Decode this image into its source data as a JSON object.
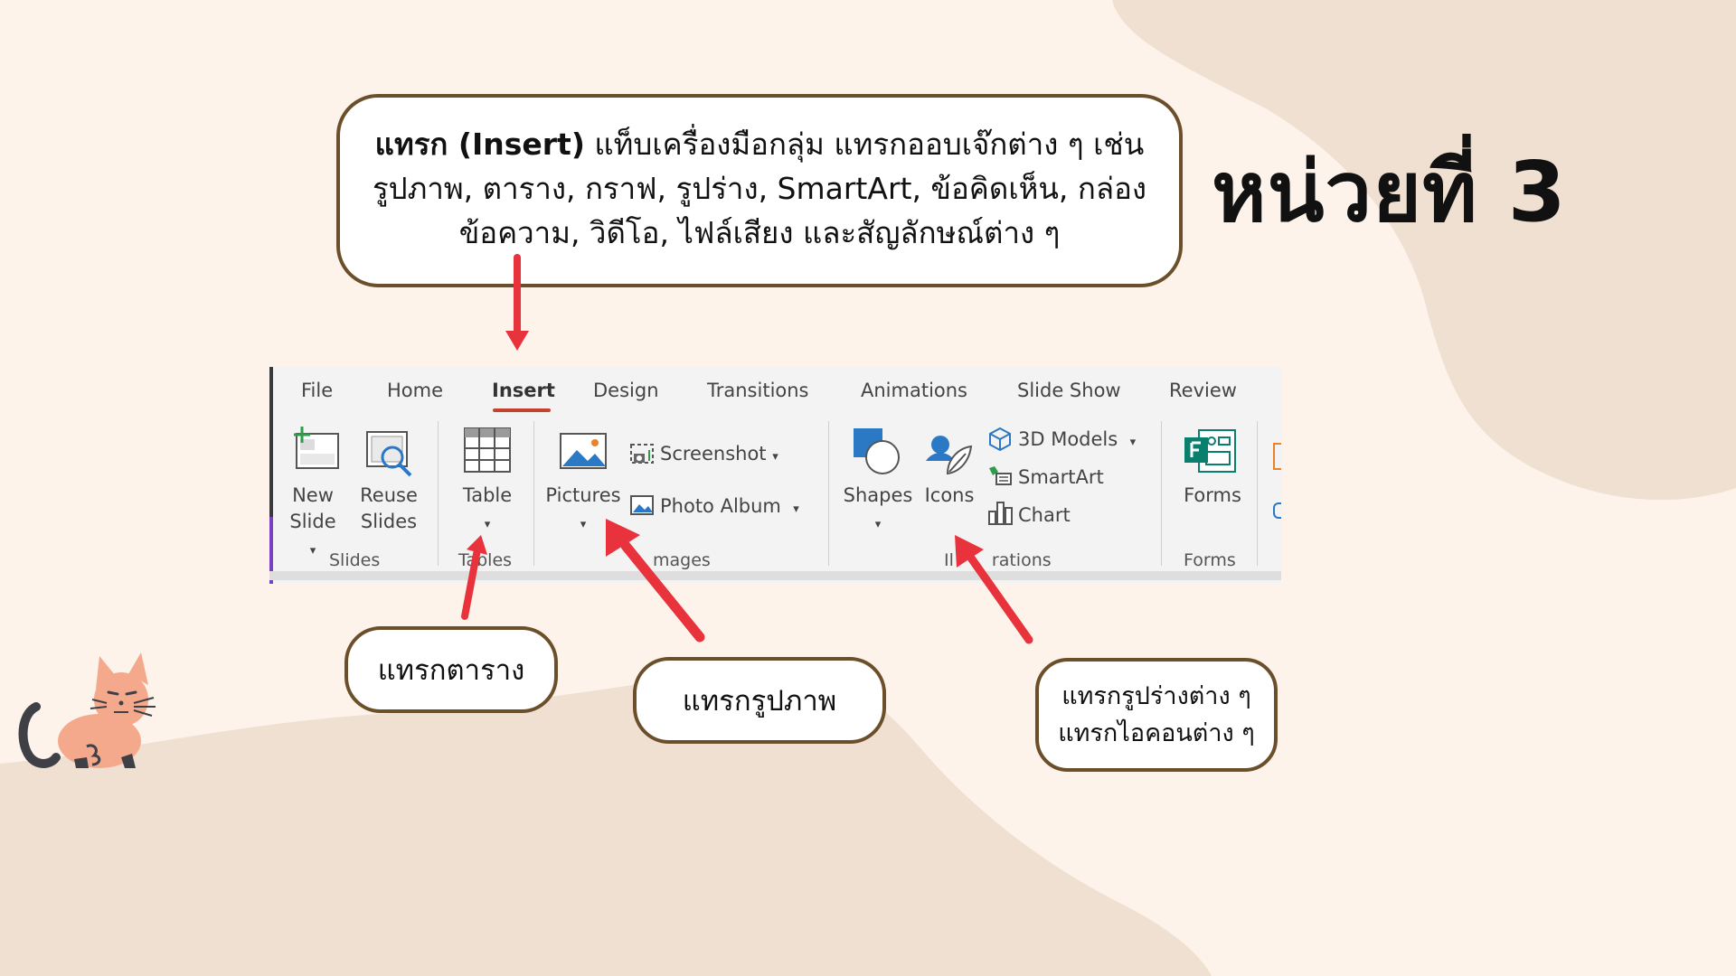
{
  "slide": {
    "title": "หน่วยที่ 3",
    "main_callout": {
      "bold_text": "แทรก (Insert)",
      "line1_rest": " แท็บเครื่องมือกลุ่ม แทรกออบเจ๊กต่าง ๆ เช่น",
      "line2": "รูปภาพ, ตาราง, กราฟ, รูปร่าง, SmartArt, ข้อคิดเห็น, กล่อง",
      "line3": "ข้อความ, วิดีโอ, ไฟล์เสียง และสัญลักษณ์ต่าง ๆ"
    },
    "callout_table": "แทรกตาราง",
    "callout_pictures": "แทรกรูปภาพ",
    "callout_shapes_line1": "แทรกรูปร่างต่าง ๆ",
    "callout_shapes_line2": "แทรกไอคอนต่าง ๆ"
  },
  "ribbon": {
    "tabs": [
      "File",
      "Home",
      "Insert",
      "Design",
      "Transitions",
      "Animations",
      "Slide Show",
      "Review"
    ],
    "active_tab": "Insert",
    "groups": {
      "slides": {
        "label": "Slides",
        "new_slide_line1": "New",
        "new_slide_line2": "Slide",
        "reuse_line1": "Reuse",
        "reuse_line2": "Slides"
      },
      "tables": {
        "label": "Ta",
        "label_tail": "bles",
        "table": "Table"
      },
      "images": {
        "label": "Images",
        "label_tail": "mages",
        "pictures": "Pictures",
        "screenshot": "Screenshot",
        "photo_album": "Photo Album"
      },
      "illustrations": {
        "label_head": "Il",
        "label_tail": "rations",
        "shapes": "Shapes",
        "icons": "Icons",
        "models_3d": "3D Models",
        "smartart": "SmartArt",
        "chart": "Chart"
      },
      "forms": {
        "label": "Forms",
        "forms": "Forms"
      }
    }
  },
  "colors": {
    "background": "#fdf3ea",
    "blob": "#efe0d1",
    "callout_border": "#6b4f2a",
    "arrow": "#e8323c",
    "active_tab_underline": "#c4432d"
  }
}
